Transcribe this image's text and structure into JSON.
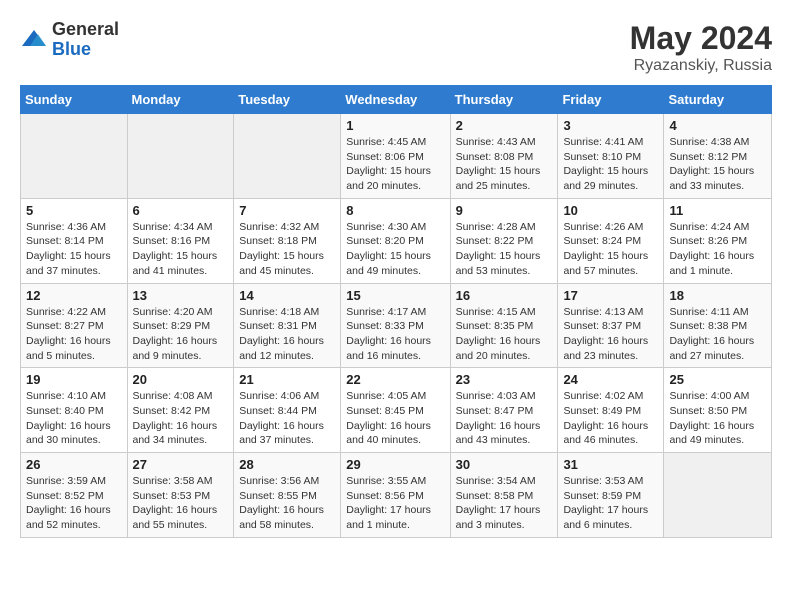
{
  "logo": {
    "general": "General",
    "blue": "Blue"
  },
  "header": {
    "title": "May 2024",
    "subtitle": "Ryazanskiy, Russia"
  },
  "days_of_week": [
    "Sunday",
    "Monday",
    "Tuesday",
    "Wednesday",
    "Thursday",
    "Friday",
    "Saturday"
  ],
  "weeks": [
    [
      {
        "day": "",
        "detail": ""
      },
      {
        "day": "",
        "detail": ""
      },
      {
        "day": "",
        "detail": ""
      },
      {
        "day": "1",
        "detail": "Sunrise: 4:45 AM\nSunset: 8:06 PM\nDaylight: 15 hours\nand 20 minutes."
      },
      {
        "day": "2",
        "detail": "Sunrise: 4:43 AM\nSunset: 8:08 PM\nDaylight: 15 hours\nand 25 minutes."
      },
      {
        "day": "3",
        "detail": "Sunrise: 4:41 AM\nSunset: 8:10 PM\nDaylight: 15 hours\nand 29 minutes."
      },
      {
        "day": "4",
        "detail": "Sunrise: 4:38 AM\nSunset: 8:12 PM\nDaylight: 15 hours\nand 33 minutes."
      }
    ],
    [
      {
        "day": "5",
        "detail": "Sunrise: 4:36 AM\nSunset: 8:14 PM\nDaylight: 15 hours\nand 37 minutes."
      },
      {
        "day": "6",
        "detail": "Sunrise: 4:34 AM\nSunset: 8:16 PM\nDaylight: 15 hours\nand 41 minutes."
      },
      {
        "day": "7",
        "detail": "Sunrise: 4:32 AM\nSunset: 8:18 PM\nDaylight: 15 hours\nand 45 minutes."
      },
      {
        "day": "8",
        "detail": "Sunrise: 4:30 AM\nSunset: 8:20 PM\nDaylight: 15 hours\nand 49 minutes."
      },
      {
        "day": "9",
        "detail": "Sunrise: 4:28 AM\nSunset: 8:22 PM\nDaylight: 15 hours\nand 53 minutes."
      },
      {
        "day": "10",
        "detail": "Sunrise: 4:26 AM\nSunset: 8:24 PM\nDaylight: 15 hours\nand 57 minutes."
      },
      {
        "day": "11",
        "detail": "Sunrise: 4:24 AM\nSunset: 8:26 PM\nDaylight: 16 hours\nand 1 minute."
      }
    ],
    [
      {
        "day": "12",
        "detail": "Sunrise: 4:22 AM\nSunset: 8:27 PM\nDaylight: 16 hours\nand 5 minutes."
      },
      {
        "day": "13",
        "detail": "Sunrise: 4:20 AM\nSunset: 8:29 PM\nDaylight: 16 hours\nand 9 minutes."
      },
      {
        "day": "14",
        "detail": "Sunrise: 4:18 AM\nSunset: 8:31 PM\nDaylight: 16 hours\nand 12 minutes."
      },
      {
        "day": "15",
        "detail": "Sunrise: 4:17 AM\nSunset: 8:33 PM\nDaylight: 16 hours\nand 16 minutes."
      },
      {
        "day": "16",
        "detail": "Sunrise: 4:15 AM\nSunset: 8:35 PM\nDaylight: 16 hours\nand 20 minutes."
      },
      {
        "day": "17",
        "detail": "Sunrise: 4:13 AM\nSunset: 8:37 PM\nDaylight: 16 hours\nand 23 minutes."
      },
      {
        "day": "18",
        "detail": "Sunrise: 4:11 AM\nSunset: 8:38 PM\nDaylight: 16 hours\nand 27 minutes."
      }
    ],
    [
      {
        "day": "19",
        "detail": "Sunrise: 4:10 AM\nSunset: 8:40 PM\nDaylight: 16 hours\nand 30 minutes."
      },
      {
        "day": "20",
        "detail": "Sunrise: 4:08 AM\nSunset: 8:42 PM\nDaylight: 16 hours\nand 34 minutes."
      },
      {
        "day": "21",
        "detail": "Sunrise: 4:06 AM\nSunset: 8:44 PM\nDaylight: 16 hours\nand 37 minutes."
      },
      {
        "day": "22",
        "detail": "Sunrise: 4:05 AM\nSunset: 8:45 PM\nDaylight: 16 hours\nand 40 minutes."
      },
      {
        "day": "23",
        "detail": "Sunrise: 4:03 AM\nSunset: 8:47 PM\nDaylight: 16 hours\nand 43 minutes."
      },
      {
        "day": "24",
        "detail": "Sunrise: 4:02 AM\nSunset: 8:49 PM\nDaylight: 16 hours\nand 46 minutes."
      },
      {
        "day": "25",
        "detail": "Sunrise: 4:00 AM\nSunset: 8:50 PM\nDaylight: 16 hours\nand 49 minutes."
      }
    ],
    [
      {
        "day": "26",
        "detail": "Sunrise: 3:59 AM\nSunset: 8:52 PM\nDaylight: 16 hours\nand 52 minutes."
      },
      {
        "day": "27",
        "detail": "Sunrise: 3:58 AM\nSunset: 8:53 PM\nDaylight: 16 hours\nand 55 minutes."
      },
      {
        "day": "28",
        "detail": "Sunrise: 3:56 AM\nSunset: 8:55 PM\nDaylight: 16 hours\nand 58 minutes."
      },
      {
        "day": "29",
        "detail": "Sunrise: 3:55 AM\nSunset: 8:56 PM\nDaylight: 17 hours\nand 1 minute."
      },
      {
        "day": "30",
        "detail": "Sunrise: 3:54 AM\nSunset: 8:58 PM\nDaylight: 17 hours\nand 3 minutes."
      },
      {
        "day": "31",
        "detail": "Sunrise: 3:53 AM\nSunset: 8:59 PM\nDaylight: 17 hours\nand 6 minutes."
      },
      {
        "day": "",
        "detail": ""
      }
    ]
  ]
}
